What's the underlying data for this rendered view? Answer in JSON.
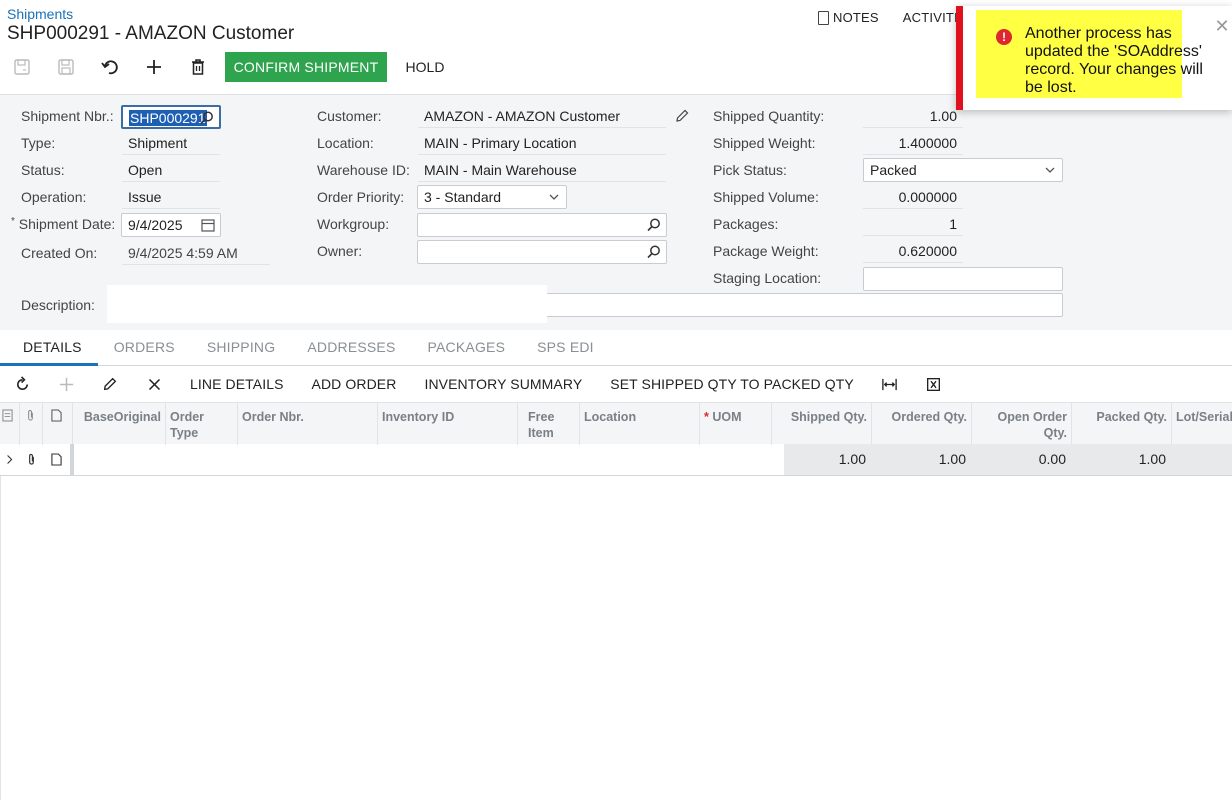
{
  "header": {
    "breadcrumb": "Shipments",
    "title": "SHP000291 - AMAZON Customer",
    "notes_label": "NOTES",
    "activities_label": "ACTIVITI"
  },
  "toolbar": {
    "confirm_label": "CONFIRM SHIPMENT",
    "hold_label": "HOLD"
  },
  "form": {
    "shipment_nbr_label": "Shipment Nbr.:",
    "shipment_nbr": "SHP000291",
    "type_label": "Type:",
    "type": "Shipment",
    "status_label": "Status:",
    "status": "Open",
    "operation_label": "Operation:",
    "operation": "Issue",
    "shipment_date_label": "Shipment Date:",
    "shipment_date": "9/4/2025",
    "created_on_label": "Created On:",
    "created_on": "9/4/2025 4:59 AM",
    "description_label": "Description:",
    "customer_label": "Customer:",
    "customer": "AMAZON - AMAZON Customer",
    "location_label": "Location:",
    "location": "MAIN - Primary Location",
    "warehouse_label": "Warehouse ID:",
    "warehouse": "MAIN - Main Warehouse",
    "order_priority_label": "Order Priority:",
    "order_priority": "3 - Standard",
    "workgroup_label": "Workgroup:",
    "owner_label": "Owner:",
    "shipped_qty_label": "Shipped Quantity:",
    "shipped_qty": "1.00",
    "shipped_weight_label": "Shipped Weight:",
    "shipped_weight": "1.400000",
    "pick_status_label": "Pick Status:",
    "pick_status": "Packed",
    "shipped_volume_label": "Shipped Volume:",
    "shipped_volume": "0.000000",
    "packages_label": "Packages:",
    "packages": "1",
    "package_weight_label": "Package Weight:",
    "package_weight": "0.620000",
    "staging_location_label": "Staging Location:"
  },
  "tabs": [
    "DETAILS",
    "ORDERS",
    "SHIPPING",
    "ADDRESSES",
    "PACKAGES",
    "SPS EDI"
  ],
  "grid_toolbar": {
    "line_details": "LINE DETAILS",
    "add_order": "ADD ORDER",
    "inventory_summary": "INVENTORY SUMMARY",
    "set_shipped": "SET SHIPPED QTY TO PACKED QTY"
  },
  "grid": {
    "columns": {
      "base_original": "BaseOriginal",
      "order_type": "Order Type",
      "order_nbr": "Order Nbr.",
      "inventory_id": "Inventory ID",
      "free_item": "Free Item",
      "location": "Location",
      "uom": "UOM",
      "shipped_qty": "Shipped Qty.",
      "ordered_qty": "Ordered Qty.",
      "open_order_qty": "Open Order Qty.",
      "packed_qty": "Packed Qty.",
      "lot_serial": "Lot/Serial"
    },
    "rows": [
      {
        "shipped_qty": "1.00",
        "ordered_qty": "1.00",
        "open_order_qty": "0.00",
        "packed_qty": "1.00"
      }
    ]
  },
  "toast": {
    "message": "Another process has updated the 'SOAddress' record. Your changes will be lost.",
    "icon": "!"
  }
}
